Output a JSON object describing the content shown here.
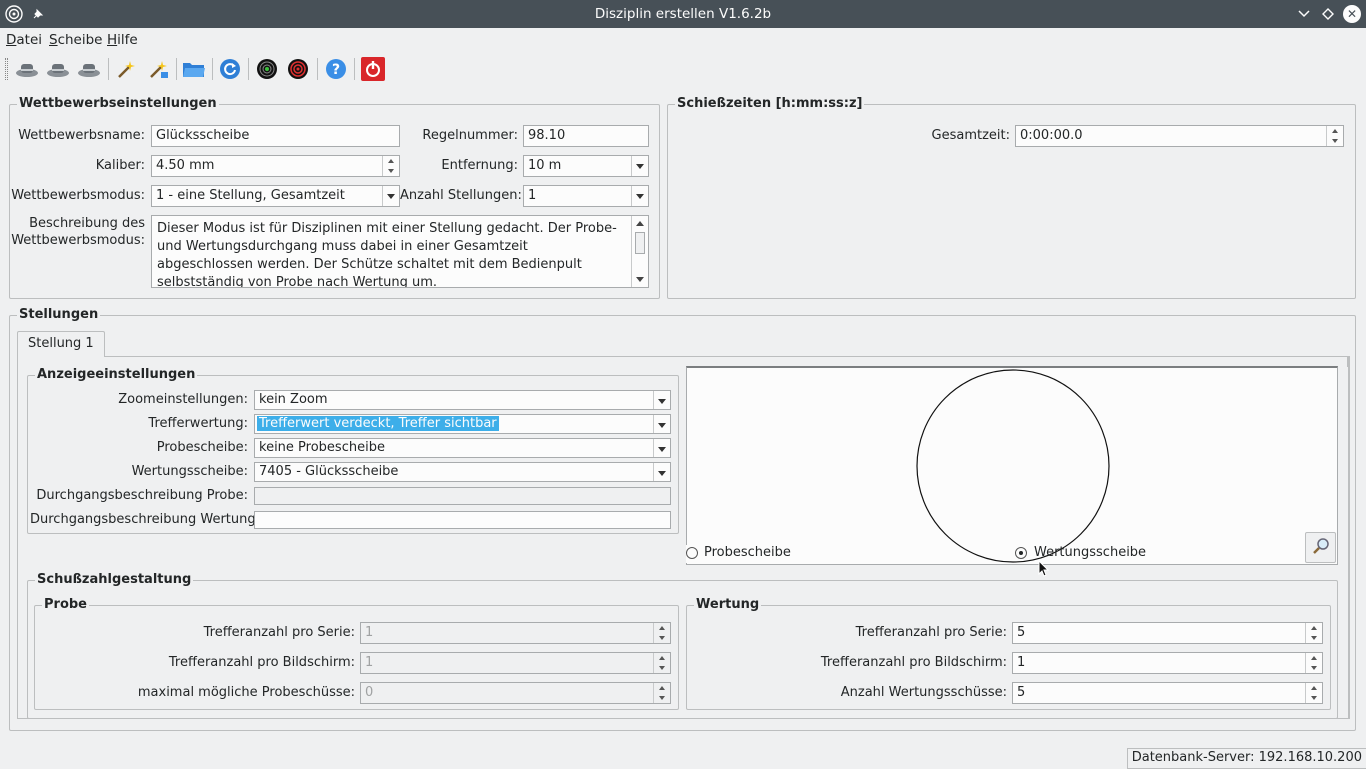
{
  "window": {
    "title": "Disziplin erstellen V1.6.2b",
    "app_icon": "target-app-icon",
    "pin_icon": "pin-icon",
    "buttons": [
      "minimize-icon",
      "maximize-icon",
      "close-icon"
    ]
  },
  "menu": {
    "items": [
      {
        "label": "Datei",
        "mnemonic": "D"
      },
      {
        "label": "Scheibe",
        "mnemonic": "S"
      },
      {
        "label": "Hilfe",
        "mnemonic": "H"
      }
    ]
  },
  "toolbar": {
    "icons": [
      "hat-1-icon",
      "hat-2-icon",
      "hat-3-icon",
      "magic-wand-icon",
      "magic-wand-star-icon",
      "open-folder-icon",
      "refresh-icon",
      "target-green-icon",
      "target-red-icon",
      "help-icon",
      "power-icon"
    ]
  },
  "competition": {
    "title": "Wettbewerbseinstellungen",
    "name_label": "Wettbewerbsname:",
    "name_value": "Glücksscheibe",
    "rule_label": "Regelnummer:",
    "rule_value": "98.10",
    "caliber_label": "Kaliber:",
    "caliber_value": "4.50 mm",
    "distance_label": "Entfernung:",
    "distance_value": "10 m",
    "mode_label": "Wettbewerbsmodus:",
    "mode_value": "1 - eine Stellung, Gesamtzeit",
    "positions_label": "Anzahl Stellungen:",
    "positions_value": "1",
    "description_label_1": "Beschreibung des",
    "description_label_2": "Wettbewerbsmodus:",
    "description_text": "Dieser Modus ist für Disziplinen mit einer Stellung gedacht. Der Probe- und Wertungsdurchgang muss dabei in einer Gesamtzeit abgeschlossen werden. Der Schütze schaltet mit dem Bedienpult selbstständig von Probe nach Wertung um."
  },
  "times": {
    "title": "Schießzeiten [h:mm:ss:z]",
    "total_label": "Gesamtzeit:",
    "total_value": "0:00:00.0"
  },
  "positions": {
    "title": "Stellungen",
    "tabs": [
      "Stellung 1"
    ],
    "display": {
      "title": "Anzeigeeinstellungen",
      "zoom_label": "Zoomeinstellungen:",
      "zoom_value": "kein Zoom",
      "hit_label": "Trefferwertung:",
      "hit_value": "Trefferwert verdeckt, Treffer sichtbar",
      "practice_target_label": "Probescheibe:",
      "practice_target_value": "keine Probescheibe",
      "scoring_target_label": "Wertungsscheibe:",
      "scoring_target_value": "7405 - Glücksscheibe",
      "practice_desc_label": "Durchgangsbeschreibung Probe:",
      "practice_desc_value": "",
      "scoring_desc_label": "Durchgangsbeschreibung Wertung:",
      "scoring_desc_value": ""
    },
    "preview": {
      "radio_practice": "Probescheibe",
      "radio_scoring": "Wertungsscheibe",
      "selected": "Wertungsscheibe",
      "zoom_icon": "magnifier-icon"
    },
    "shots": {
      "title": "Schußzahlgestaltung",
      "practice": {
        "title": "Probe",
        "per_series_label": "Trefferanzahl pro Serie:",
        "per_series_value": "1",
        "per_screen_label": "Trefferanzahl pro Bildschirm:",
        "per_screen_value": "1",
        "max_label": "maximal mögliche Probeschüsse:",
        "max_value": "0"
      },
      "scoring": {
        "title": "Wertung",
        "per_series_label": "Trefferanzahl pro Serie:",
        "per_series_value": "5",
        "per_screen_label": "Trefferanzahl pro Bildschirm:",
        "per_screen_value": "1",
        "count_label": "Anzahl Wertungsschüsse:",
        "count_value": "5"
      }
    }
  },
  "status": {
    "server": "Datenbank-Server: 192.168.10.200"
  },
  "colors": {
    "titlebar": "#475057",
    "background": "#eff0f1",
    "selection": "#3daee9"
  }
}
